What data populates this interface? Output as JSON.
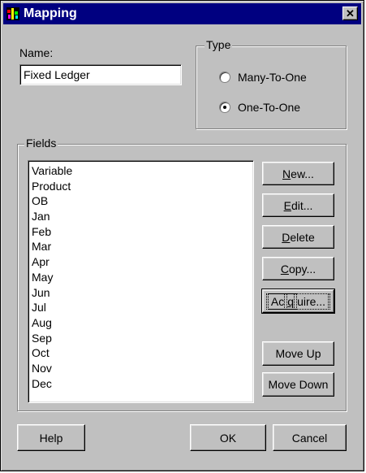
{
  "window": {
    "title": "Mapping",
    "close_glyph": "✕"
  },
  "name_field": {
    "label": "Name:",
    "value": "Fixed Ledger"
  },
  "type_group": {
    "caption": "Type",
    "options": [
      {
        "label": "Many-To-One",
        "checked": false
      },
      {
        "label": "One-To-One",
        "checked": true
      }
    ]
  },
  "fields_group": {
    "caption": "Fields",
    "items": [
      "Variable",
      "Product",
      "OB",
      "Jan",
      "Feb",
      "Mar",
      "Apr",
      "May",
      "Jun",
      "Jul",
      "Aug",
      "Sep",
      "Oct",
      "Nov",
      "Dec"
    ],
    "buttons": {
      "new": {
        "accel": "N",
        "rest": "ew..."
      },
      "edit": {
        "accel": "E",
        "rest": "dit..."
      },
      "delete": {
        "accel": "D",
        "rest": "elete"
      },
      "copy": {
        "accel": "C",
        "rest": "opy..."
      },
      "acquire": {
        "pre": "Ac",
        "accel": "q",
        "rest": "uire..."
      },
      "move_up": "Move Up",
      "move_down": "Move Down"
    }
  },
  "footer": {
    "help": "Help",
    "ok": "OK",
    "cancel": "Cancel"
  }
}
